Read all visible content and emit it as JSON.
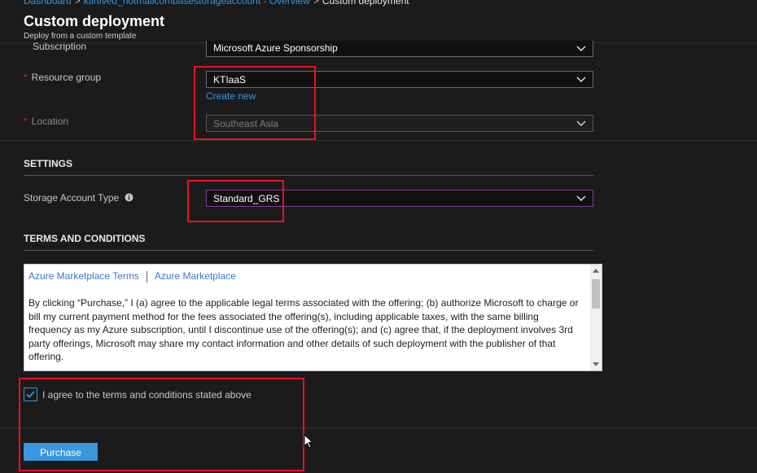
{
  "breadcrumb": {
    "items": [
      "Dashboard",
      "ktlrtived_hotmailcombasestorageaccount - Overview"
    ],
    "current": "Custom deployment",
    "separator": ">"
  },
  "header": {
    "title": "Custom deployment",
    "subtitle": "Deploy from a custom template"
  },
  "basics": {
    "subscription": {
      "label": "Subscription",
      "value": "Microsoft Azure Sponsorship"
    },
    "resource_group": {
      "label": "Resource group",
      "value": "KTIaaS",
      "create_new": "Create new",
      "required_mark": "*"
    },
    "location": {
      "label": "Location",
      "value": "Southeast Asia",
      "required_mark": "*"
    }
  },
  "settings": {
    "heading": "SETTINGS",
    "storage_type": {
      "label": "Storage Account Type",
      "value": "Standard_GRS"
    }
  },
  "terms": {
    "heading": "TERMS AND CONDITIONS",
    "tab1": "Azure Marketplace Terms",
    "tab2": "Azure Marketplace",
    "text": "By clicking “Purchase,” I (a) agree to the applicable legal terms associated with the offering; (b) authorize Microsoft to charge or bill my current payment method for the fees associated the offering(s), including applicable taxes, with the same billing frequency as my Azure subscription, until I discontinue use of the offering(s); and (c) agree that, if the deployment involves 3rd party offerings, Microsoft may share my contact information and other details of such deployment with the publisher of that offering.",
    "agree_label": "I agree to the terms and conditions stated above",
    "agree_checked": true
  },
  "actions": {
    "purchase": "Purchase"
  },
  "colors": {
    "accent": "#3a96dd",
    "highlight": "#e81123",
    "required": "#e81123",
    "background": "#1b1b1b"
  },
  "icons": {
    "dropdown": "chevron-down-icon",
    "info": "info-icon",
    "check": "checkmark-icon",
    "cursor": "mouse-pointer-icon"
  }
}
